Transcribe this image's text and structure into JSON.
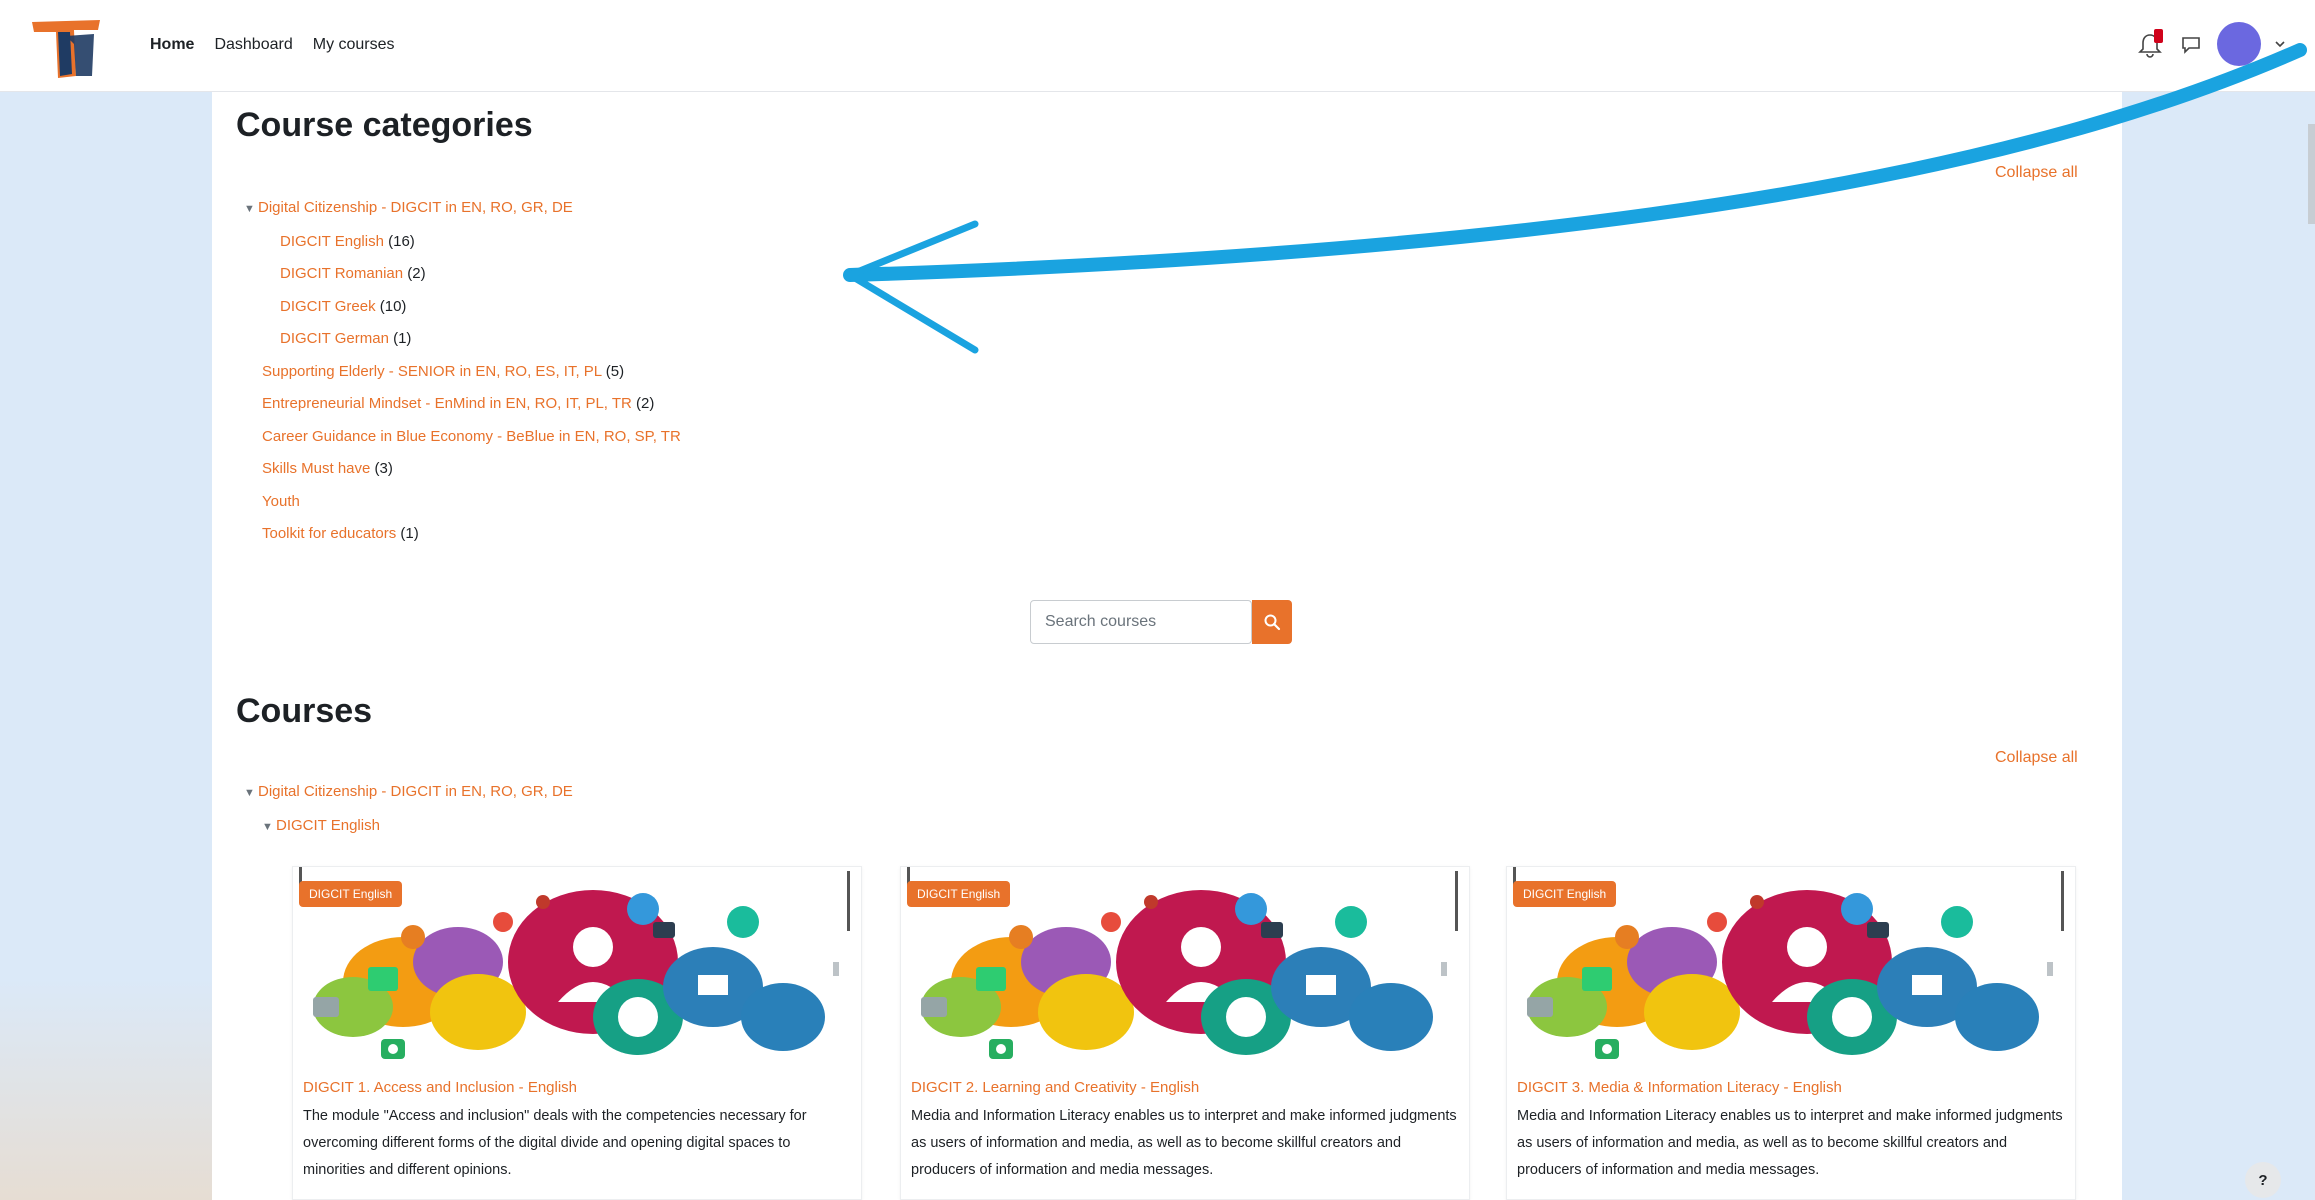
{
  "nav": {
    "links": [
      "Home",
      "Dashboard",
      "My courses"
    ]
  },
  "categories": {
    "title": "Course categories",
    "collapse_label": "Collapse all",
    "tree": [
      {
        "label": "Digital Citizenship - DIGCIT in EN, RO, GR, DE",
        "count": "",
        "expanded": true,
        "level": 0
      },
      {
        "label": "DIGCIT English",
        "count": "(16)",
        "level": 1
      },
      {
        "label": "DIGCIT Romanian",
        "count": "(2)",
        "level": 1
      },
      {
        "label": "DIGCIT Greek",
        "count": "(10)",
        "level": 1
      },
      {
        "label": "DIGCIT German",
        "count": "(1)",
        "level": 1
      },
      {
        "label": "Supporting Elderly - SENIOR in EN, RO, ES, IT, PL",
        "count": "(5)",
        "level": 0
      },
      {
        "label": "Entrepreneurial Mindset - EnMind in EN, RO, IT, PL, TR",
        "count": "(2)",
        "level": 0
      },
      {
        "label": "Career Guidance in Blue Economy - BeBlue in EN, RO, SP, TR",
        "count": "",
        "level": 0
      },
      {
        "label": "Skills Must have",
        "count": "(3)",
        "level": 0
      },
      {
        "label": "Youth",
        "count": "",
        "level": 0
      },
      {
        "label": "Toolkit for educators",
        "count": "(1)",
        "level": 0
      }
    ]
  },
  "search": {
    "placeholder": "Search courses"
  },
  "courses": {
    "title": "Courses",
    "collapse_label": "Collapse all",
    "tree": [
      {
        "label": "Digital Citizenship - DIGCIT in EN, RO, GR, DE",
        "level": 0
      },
      {
        "label": "DIGCIT English",
        "level": 1
      }
    ],
    "cards": [
      {
        "tag": "DIGCIT English",
        "title": "DIGCIT 1. Access and Inclusion - English",
        "summary": "The module \"Access and inclusion\" deals with the competencies necessary for overcoming different forms of the digital divide and opening digital spaces to minorities and different opinions."
      },
      {
        "tag": "DIGCIT English",
        "title": "DIGCIT 2. Learning and Creativity - English",
        "summary": "Media and Information Literacy enables us to interpret and make informed judgments as users of information and media, as well as to become skillful creators and producers of information and media messages."
      },
      {
        "tag": "DIGCIT English",
        "title": "DIGCIT 3. Media & Information Literacy - English",
        "summary": "Media and Information Literacy enables us to interpret and make informed judgments as users of information and media, as well as to become skillful creators and producers of information and media messages."
      }
    ]
  },
  "help": {
    "label": "?"
  },
  "colors": {
    "accent": "#e8722b",
    "page_bg": "#dbe9f8",
    "arrow": "#1aa3e0",
    "avatar": "#6b68e0"
  }
}
